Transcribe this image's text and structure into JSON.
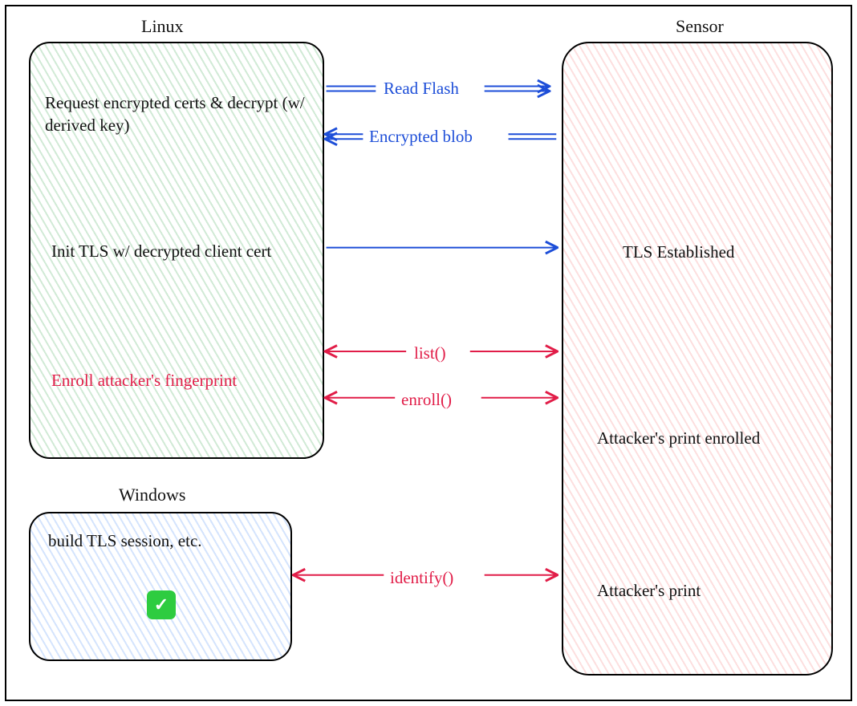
{
  "titles": {
    "linux": "Linux",
    "windows": "Windows",
    "sensor": "Sensor"
  },
  "linux": {
    "request": "Request encrypted certs & decrypt (w/ derived key)",
    "init_tls": "Init TLS w/ decrypted client cert",
    "enroll_attacker": "Enroll attacker's fingerprint"
  },
  "windows": {
    "build": "build TLS session, etc.",
    "check_glyph": "✓"
  },
  "sensor": {
    "tls_established": "TLS Established",
    "attacker_enrolled": "Attacker's print enrolled",
    "attacker_print": "Attacker's print"
  },
  "arrows": {
    "read_flash": "Read Flash",
    "encrypted_blob": "Encrypted blob",
    "list": "list()",
    "enroll": "enroll()",
    "identify": "identify()"
  },
  "colors": {
    "blue": "#1d4ed8",
    "red": "#e11d48",
    "green_hatch": "#2ea043",
    "blue_hatch": "#3b82f6",
    "red_hatch": "#f87171"
  }
}
